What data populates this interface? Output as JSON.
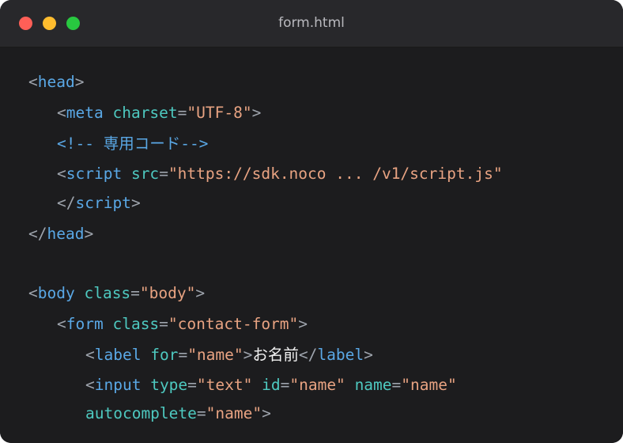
{
  "window": {
    "title": "form.html",
    "controls": [
      {
        "name": "close",
        "color": "#ff5f57"
      },
      {
        "name": "minimize",
        "color": "#febc2e"
      },
      {
        "name": "zoom",
        "color": "#28c840"
      }
    ]
  },
  "theme": {
    "tag": "#5aa8e6",
    "attr": "#4ec9c0",
    "string": "#e8a382",
    "punct": "#9ea4ad",
    "comment": "#5aa8e6",
    "text": "#f0f0f0",
    "background": "#1c1c1e",
    "titlebar": "#28282b"
  },
  "code": {
    "lines": [
      {
        "indent": 0,
        "tokens": [
          [
            "punct",
            "<"
          ],
          [
            "tag",
            "head"
          ],
          [
            "punct",
            ">"
          ]
        ]
      },
      {
        "indent": 1,
        "tokens": [
          [
            "punct",
            "<"
          ],
          [
            "tag",
            "meta"
          ],
          [
            "punct",
            " "
          ],
          [
            "attr",
            "charset"
          ],
          [
            "punct",
            "="
          ],
          [
            "string",
            "\"UTF-8\""
          ],
          [
            "punct",
            ">"
          ]
        ]
      },
      {
        "indent": 1,
        "tokens": [
          [
            "comment",
            "<!-- 専用コード-->"
          ]
        ]
      },
      {
        "indent": 1,
        "tokens": [
          [
            "punct",
            "<"
          ],
          [
            "tag",
            "script"
          ],
          [
            "punct",
            " "
          ],
          [
            "attr",
            "src"
          ],
          [
            "punct",
            "="
          ],
          [
            "string",
            "\"https://sdk.noco ... /v1/script.js\""
          ]
        ]
      },
      {
        "indent": 1,
        "tokens": [
          [
            "punct",
            "</"
          ],
          [
            "tag",
            "script"
          ],
          [
            "punct",
            ">"
          ]
        ]
      },
      {
        "indent": 0,
        "tokens": [
          [
            "punct",
            "</"
          ],
          [
            "tag",
            "head"
          ],
          [
            "punct",
            ">"
          ]
        ]
      },
      {
        "indent": 0,
        "tokens": []
      },
      {
        "indent": 0,
        "tokens": [
          [
            "punct",
            "<"
          ],
          [
            "tag",
            "body"
          ],
          [
            "punct",
            " "
          ],
          [
            "attr",
            "class"
          ],
          [
            "punct",
            "="
          ],
          [
            "string",
            "\"body\""
          ],
          [
            "punct",
            ">"
          ]
        ]
      },
      {
        "indent": 1,
        "tokens": [
          [
            "punct",
            "<"
          ],
          [
            "tag",
            "form"
          ],
          [
            "punct",
            " "
          ],
          [
            "attr",
            "class"
          ],
          [
            "punct",
            "="
          ],
          [
            "string",
            "\"contact-form\""
          ],
          [
            "punct",
            ">"
          ]
        ]
      },
      {
        "indent": 2,
        "tokens": [
          [
            "punct",
            "<"
          ],
          [
            "tag",
            "label"
          ],
          [
            "punct",
            " "
          ],
          [
            "attr",
            "for"
          ],
          [
            "punct",
            "="
          ],
          [
            "string",
            "\"name\""
          ],
          [
            "punct",
            ">"
          ],
          [
            "text",
            "お名前"
          ],
          [
            "punct",
            "</"
          ],
          [
            "tag",
            "label"
          ],
          [
            "punct",
            ">"
          ]
        ]
      },
      {
        "indent": 2,
        "tokens": [
          [
            "punct",
            "<"
          ],
          [
            "tag",
            "input"
          ],
          [
            "punct",
            " "
          ],
          [
            "attr",
            "type"
          ],
          [
            "punct",
            "="
          ],
          [
            "string",
            "\"text\""
          ],
          [
            "punct",
            " "
          ],
          [
            "attr",
            "id"
          ],
          [
            "punct",
            "="
          ],
          [
            "string",
            "\"name\""
          ],
          [
            "punct",
            " "
          ],
          [
            "attr",
            "name"
          ],
          [
            "punct",
            "="
          ],
          [
            "string",
            "\"name\""
          ]
        ]
      },
      {
        "indent": 2,
        "tokens": [
          [
            "attr",
            "autocomplete"
          ],
          [
            "punct",
            "="
          ],
          [
            "string",
            "\"name\""
          ],
          [
            "punct",
            ">"
          ]
        ]
      }
    ]
  }
}
